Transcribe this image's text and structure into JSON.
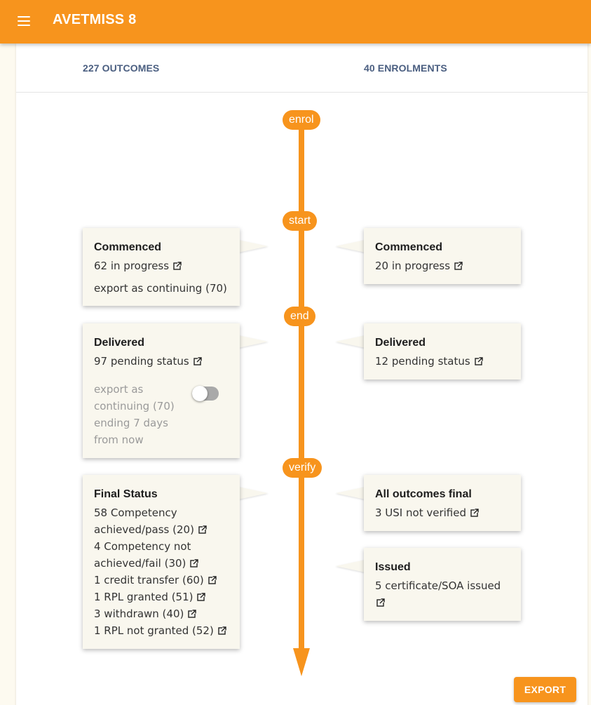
{
  "app": {
    "title": "AVETMISS 8",
    "menu_icon": "hamburger-menu-icon"
  },
  "tabs": [
    "227 OUTCOMES",
    "40 ENROLMENTS"
  ],
  "stages": [
    "enrol",
    "start",
    "end",
    "verify"
  ],
  "colors": {
    "accent": "#f7941d",
    "tab_text": "#4a5e80",
    "card_bg": "#f9f7ee",
    "page_bg": "#fdfaf0"
  },
  "outcomes": {
    "commenced": {
      "title": "Commenced",
      "in_progress": "62 in progress",
      "export_note": "export as continuing (70)"
    },
    "delivered": {
      "title": "Delivered",
      "pending": "97 pending status",
      "export_note_lines": [
        "export as",
        "continuing (70)",
        "ending 7 days",
        "from now"
      ],
      "toggle_on": false
    },
    "final_status": {
      "title": "Final Status",
      "items": [
        {
          "lines": [
            "58 Competency",
            "achieved/pass (20)"
          ]
        },
        {
          "lines": [
            "4 Competency not",
            "achieved/fail (30)"
          ]
        },
        {
          "lines": [
            "1 credit transfer (60)"
          ]
        },
        {
          "lines": [
            "1 RPL granted (51)"
          ]
        },
        {
          "lines": [
            "3 withdrawn (40)"
          ]
        },
        {
          "lines": [
            "1 RPL not granted (52)"
          ]
        }
      ]
    }
  },
  "enrolments": {
    "commenced": {
      "title": "Commenced",
      "in_progress": "20 in progress"
    },
    "delivered": {
      "title": "Delivered",
      "pending": "12 pending status"
    },
    "all_final": {
      "title": "All outcomes final",
      "usi": "3 USI not verified"
    },
    "issued": {
      "title": "Issued",
      "issued_lines": [
        "5 certificate/SOA issued"
      ]
    }
  },
  "export_label": "EXPORT"
}
